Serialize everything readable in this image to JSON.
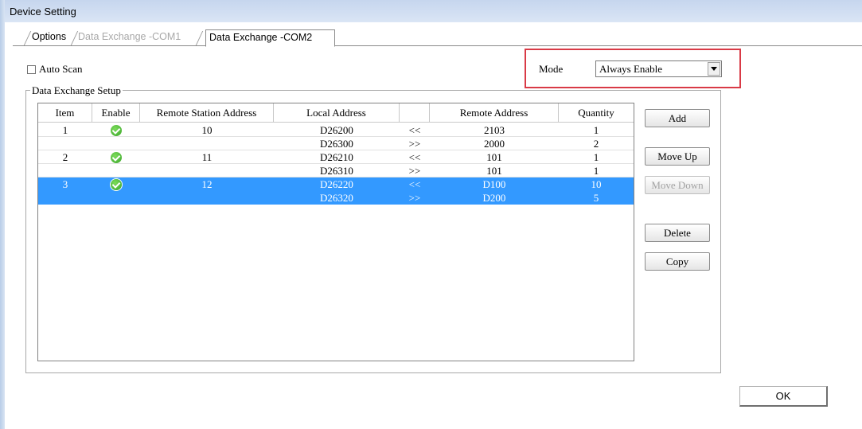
{
  "window": {
    "title": "Device Setting"
  },
  "tabs": [
    {
      "label": "Options",
      "state": "inactive"
    },
    {
      "label": "Data Exchange -COM1",
      "state": "disabled"
    },
    {
      "label": "Data Exchange -COM2",
      "state": "active"
    }
  ],
  "auto_scan": {
    "label": "Auto Scan",
    "checked": false
  },
  "mode": {
    "label": "Mode",
    "value": "Always Enable"
  },
  "group": {
    "legend": "Data Exchange Setup"
  },
  "table": {
    "columns": [
      "Item",
      "Enable",
      "Remote Station Address",
      "Local Address",
      "",
      "Remote Address",
      "Quantity"
    ],
    "rows": [
      {
        "item": "1",
        "enabled": true,
        "station": "10",
        "local": "D26200",
        "dir": "<<",
        "remote": "2103",
        "qty": "1",
        "selected": false
      },
      {
        "item": "",
        "enabled": false,
        "station": "",
        "local": "D26300",
        "dir": ">>",
        "remote": "2000",
        "qty": "2",
        "selected": false
      },
      {
        "item": "2",
        "enabled": true,
        "station": "11",
        "local": "D26210",
        "dir": "<<",
        "remote": "101",
        "qty": "1",
        "selected": false
      },
      {
        "item": "",
        "enabled": false,
        "station": "",
        "local": "D26310",
        "dir": ">>",
        "remote": "101",
        "qty": "1",
        "selected": false
      },
      {
        "item": "3",
        "enabled": true,
        "station": "12",
        "local": "D26220",
        "dir": "<<",
        "remote": "D100",
        "qty": "10",
        "selected": true
      },
      {
        "item": "",
        "enabled": false,
        "station": "",
        "local": "D26320",
        "dir": ">>",
        "remote": "D200",
        "qty": "5",
        "selected": true
      }
    ]
  },
  "buttons": {
    "add": "Add",
    "move_up": "Move Up",
    "move_down": "Move Down",
    "delete": "Delete",
    "copy": "Copy",
    "ok": "OK"
  },
  "colors": {
    "selection": "#3399ff",
    "highlight_box": "#d93a46",
    "enable_icon": "#3aa52a"
  }
}
